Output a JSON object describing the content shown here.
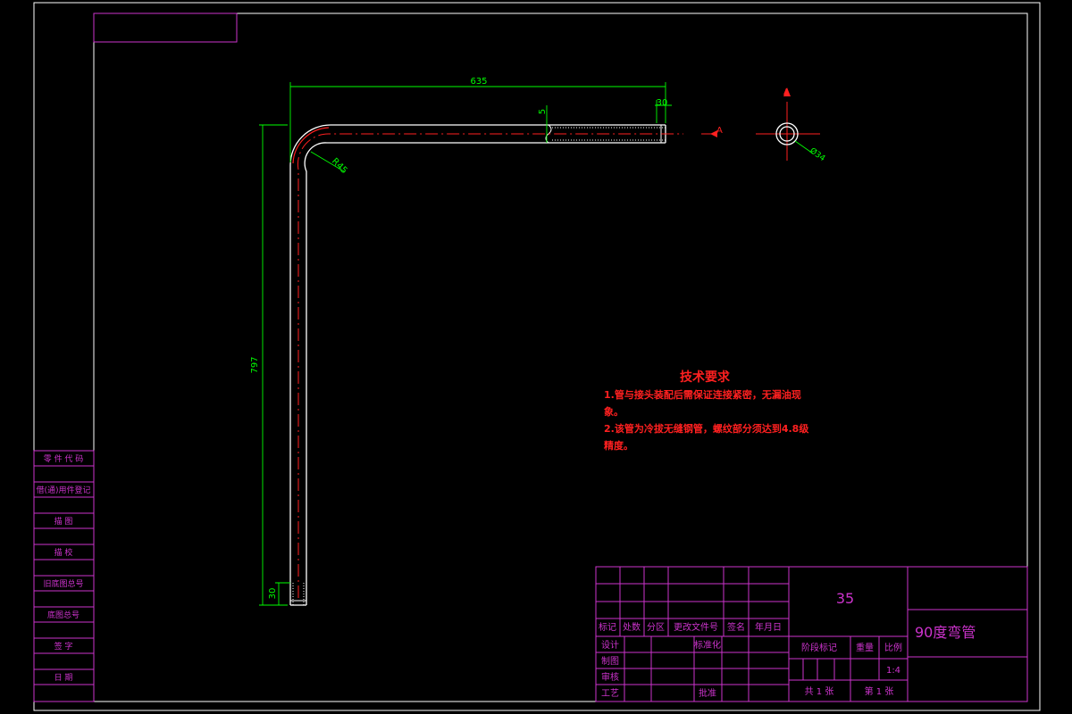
{
  "colors": {
    "background": "#000000",
    "frame": "#ffffff",
    "titleblock": "#cc33cc",
    "dimension": "#00ff00",
    "centerline": "#ff2020",
    "part": "#ffffff",
    "notes": "#ff2020"
  },
  "drawing": {
    "dim_horizontal": "635",
    "dim_end_length": "30",
    "dim_thread_offset": "5",
    "dim_radius": "R45",
    "dim_vertical": "797",
    "dim_bottom_end": "30",
    "section_label": "A",
    "section_label_top": "A",
    "dim_diameter": "Ø34"
  },
  "notes": {
    "title": "技术要求",
    "line1": "1.管与接头装配后需保证连接紧密，无漏油现",
    "line1b": "象。",
    "line2": "2.该管为冷拔无缝钢管，螺纹部分须达到4.8级",
    "line2b": "精度。"
  },
  "side_table": {
    "rows": [
      "零 件 代 码",
      "借(通)用件登记",
      "描 图",
      "描 校",
      "旧底图总号",
      "底图总号",
      "签 字",
      "日 期"
    ]
  },
  "title_block": {
    "material": "35",
    "part_name": "90度弯管",
    "rev_headers": [
      "标记",
      "处数",
      "分区",
      "更改文件号",
      "签名",
      "年月日"
    ],
    "designer_label": "设计",
    "standardization_label": "标准化",
    "drafter_label": "制图",
    "checker_label": "审核",
    "process_label": "工艺",
    "approve_label": "批准",
    "stage_label": "阶段标记",
    "weight_label": "重量",
    "scale_label": "比例",
    "scale_value": "1:4",
    "total_sheets": "共  1  张",
    "sheet_no": "第  1  张"
  }
}
